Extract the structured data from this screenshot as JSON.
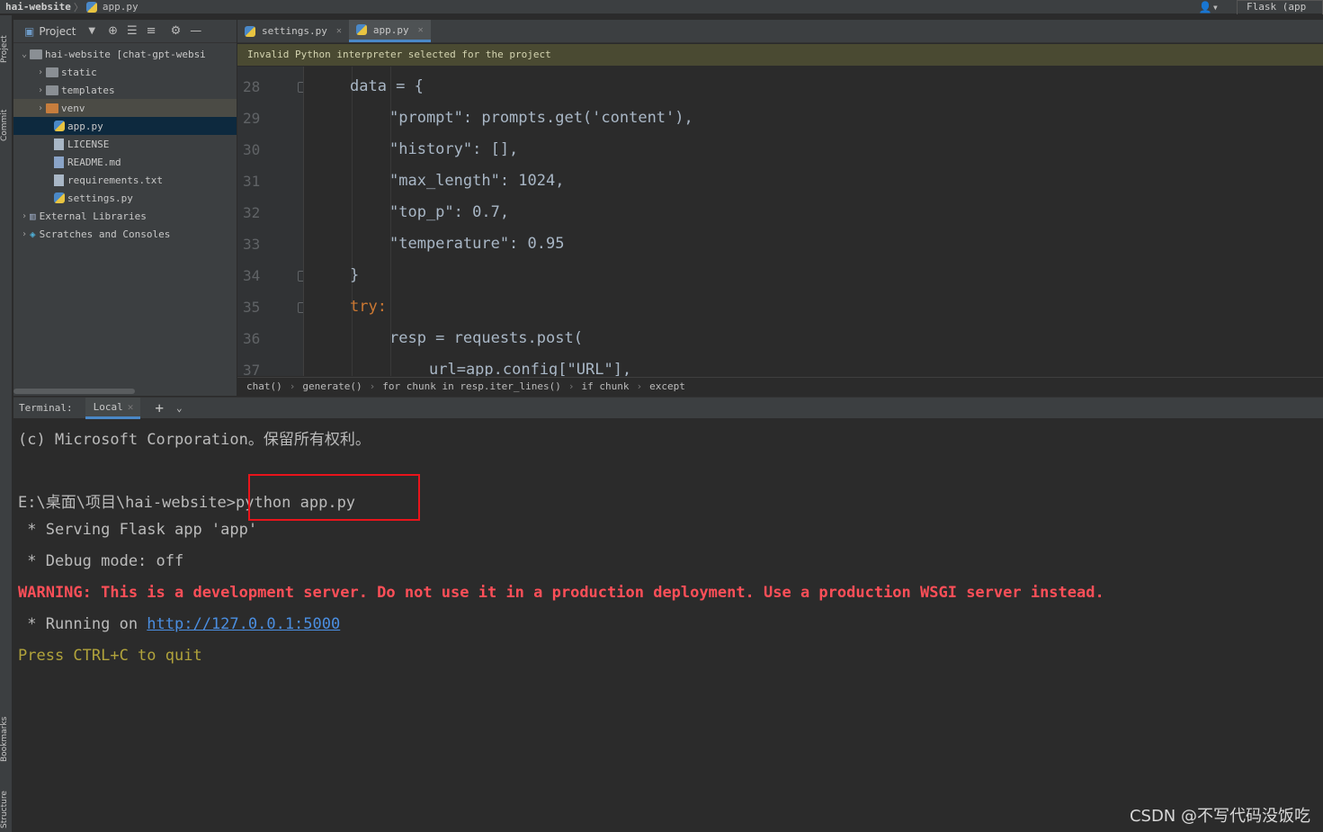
{
  "navbar": {
    "project": "hai-website",
    "file": "app.py",
    "run_config": "Flask (app"
  },
  "left_strip": {
    "project": "Project",
    "commit": "Commit",
    "bookmarks": "Bookmarks",
    "structure": "Structure"
  },
  "project_panel": {
    "title": "Project",
    "tree": [
      {
        "label": "hai-website [chat-gpt-websi",
        "type": "root"
      },
      {
        "label": "static",
        "type": "folder"
      },
      {
        "label": "templates",
        "type": "folder"
      },
      {
        "label": "venv",
        "type": "folder-orange"
      },
      {
        "label": "app.py",
        "type": "py"
      },
      {
        "label": "LICENSE",
        "type": "file"
      },
      {
        "label": "README.md",
        "type": "md"
      },
      {
        "label": "requirements.txt",
        "type": "file"
      },
      {
        "label": "settings.py",
        "type": "py"
      },
      {
        "label": "External Libraries",
        "type": "lib"
      },
      {
        "label": "Scratches and Consoles",
        "type": "scratch"
      }
    ]
  },
  "tabs": [
    {
      "label": "settings.py",
      "active": false
    },
    {
      "label": "app.py",
      "active": true
    }
  ],
  "warning": "Invalid Python interpreter selected for the project",
  "code": {
    "line_numbers": [
      "28",
      "29",
      "30",
      "31",
      "32",
      "33",
      "34",
      "35",
      "36",
      "37"
    ],
    "lines": [
      "data = {",
      "\"prompt\": prompts.get('content'),",
      "\"history\": [],",
      "\"max_length\": 1024,",
      "\"top_p\": 0.7,",
      "\"temperature\": 0.95",
      "}",
      "try:",
      "resp = requests.post(",
      "url=app.config[\"URL\"],"
    ]
  },
  "breadcrumbs": [
    "chat()",
    "generate()",
    "for chunk in resp.iter_lines()",
    "if chunk",
    "except"
  ],
  "terminal": {
    "label": "Terminal:",
    "tab": "Local",
    "lines": [
      "(c) Microsoft Corporation。保留所有权利。",
      "E:\\桌面\\项目\\hai-website>python app.py",
      " * Serving Flask app 'app'",
      " * Debug mode: off",
      "WARNING: This is a development server. Do not use it in a production deployment. Use a production WSGI server instead.",
      " * Running on ",
      "Press CTRL+C to quit"
    ],
    "url": "http://127.0.0.1:5000"
  },
  "watermark": "CSDN @不写代码没饭吃"
}
